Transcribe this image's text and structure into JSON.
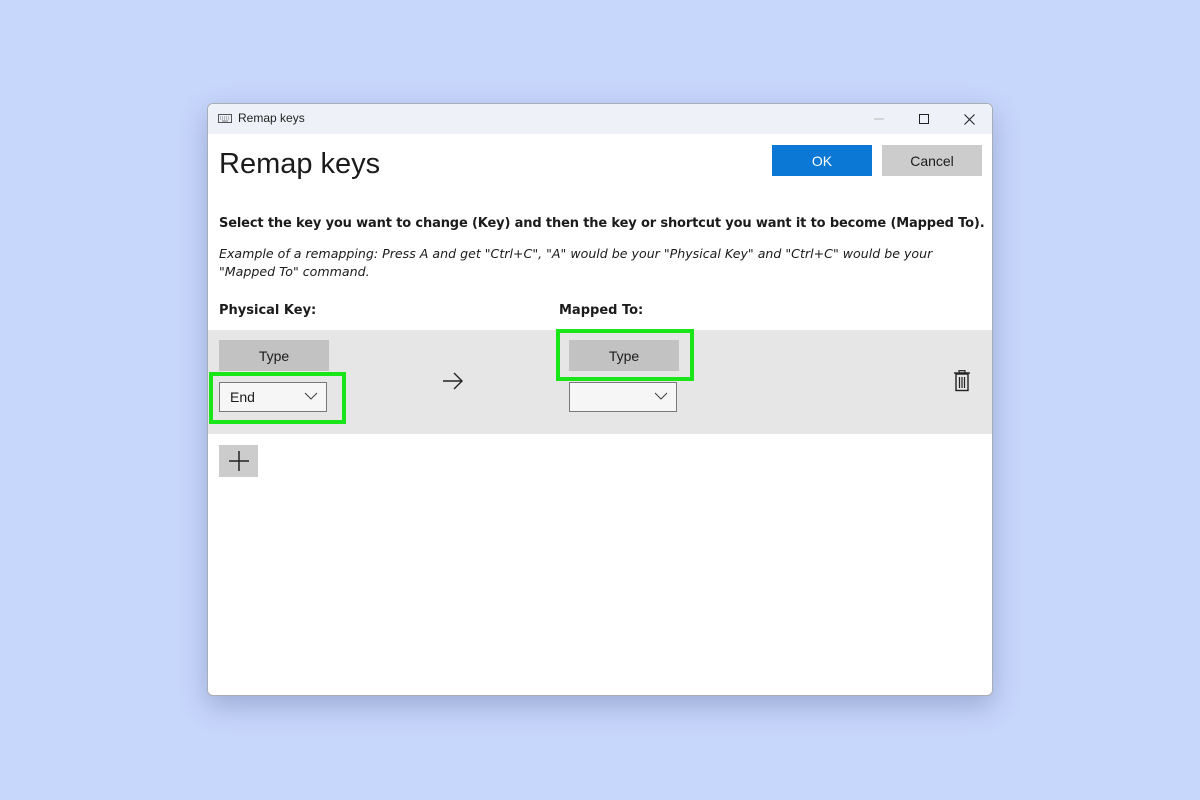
{
  "window": {
    "title": "Remap keys",
    "app_icon": "keyboard-icon",
    "controls": {
      "minimize_icon": "minimize-icon",
      "maximize_icon": "maximize-icon",
      "close_icon": "close-icon"
    }
  },
  "header": {
    "title": "Remap keys",
    "ok_label": "OK",
    "cancel_label": "Cancel"
  },
  "instructions": {
    "main": "Select the key you want to change (Key) and then the key or shortcut you want it to become (Mapped To).",
    "example": "Example of a remapping: Press A and get \"Ctrl+C\", \"A\" would be your \"Physical Key\" and \"Ctrl+C\" would be your \"Mapped To\" command."
  },
  "columns": {
    "physical_label": "Physical Key:",
    "mapped_label": "Mapped To:"
  },
  "mappings": [
    {
      "physical": {
        "type_label": "Type",
        "selected_key": "End"
      },
      "arrow_icon": "arrow-right-icon",
      "mapped": {
        "type_label": "Type",
        "selected_key": ""
      },
      "delete_icon": "trash-icon"
    }
  ],
  "add_button_icon": "plus-icon",
  "colors": {
    "background": "#c7d6fb",
    "accent": "#0a78d4",
    "highlight": "#19e619",
    "row_background": "#e6e6e6"
  }
}
